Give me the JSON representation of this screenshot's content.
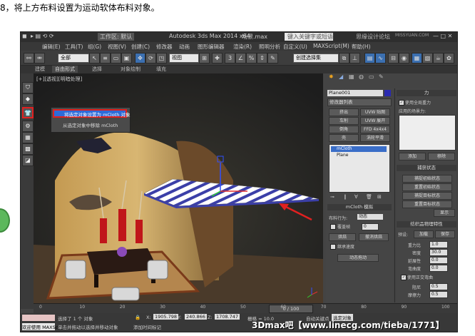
{
  "instruction": "8，将上方布料设置为运动软体布料对象。",
  "titlebar": {
    "workspace": "工作区: 默认",
    "app_title": "Autodesk 3ds Max  2014 x64",
    "file_name": "场景.max",
    "search_placeholder": "键入关键字或短语",
    "logo_text": "MISSYUAN.COM",
    "forum_text": "思缘设计论坛"
  },
  "menu": [
    "编辑(E)",
    "工具(T)",
    "组(G)",
    "视图(V)",
    "创建(C)",
    "修改器",
    "动画",
    "图形编辑器",
    "渲染(R)",
    "照明分析",
    "自定义(U)",
    "MAXScript(M)",
    "帮助(H)"
  ],
  "toolbar": {
    "filter": "全部",
    "view_mode": "视图",
    "selection_set": "创建选择集"
  },
  "ribbon": [
    "建模",
    "自由形式",
    "选择",
    "对象绘制",
    "填充"
  ],
  "viewport": {
    "label": "[+][透视][明暗处理]"
  },
  "popup": {
    "item1": "将选定对象设置为 mCloth 对象",
    "item2": "从选定对象中移除 mCloth"
  },
  "cmd_panel": {
    "object_name": "Plane001",
    "modifier_list": "修改器列表",
    "buttons": [
      "挤出",
      "UVW 贴图",
      "车削",
      "UVW 展开",
      "倒角",
      "FFD 4x4x4",
      "壳",
      "涡轮平滑"
    ],
    "stack": [
      "mCloth",
      "Plane"
    ],
    "mcloth_header": "mCloth 模拟",
    "cloth_behavior_label": "布料行为:",
    "cloth_behavior_value": "动态",
    "override_label": "覆盖帧",
    "override_value": "0",
    "bake_label": "烘焙",
    "undo_bake_label": "撤消烘焙",
    "inherit_label": "继承速度",
    "live_drag_label": "动态拖动"
  },
  "right_panel": {
    "force_header": "力",
    "use_global_gravity": "使用全局重力",
    "applied_forces": "应用的场景力:",
    "add": "添加",
    "remove": "移除",
    "capture_header": "捕获状态",
    "capture_initial": "捕捉初始状态",
    "reset_initial": "重置初始状态",
    "capture_target": "捕捉目标状态",
    "reset_target": "重置目标状态",
    "show": "显示",
    "physics_header": "纺织品物理特性",
    "preset_label": "预设:",
    "load": "加载",
    "save": "保存",
    "params": [
      {
        "label": "重力比",
        "value": "1.0"
      },
      {
        "label": "密度",
        "value": "30.0"
      },
      {
        "label": "延展性",
        "value": "0.0"
      },
      {
        "label": "弯曲度",
        "value": "0.0"
      }
    ],
    "use_ortho": "使用正交弯曲",
    "damping_label": "阻尼",
    "damping_value": "0.5",
    "friction_label": "摩擦力",
    "friction_value": "0.5"
  },
  "timeline": {
    "frame_text": "0 / 100",
    "ticks": [
      "0",
      "10",
      "20",
      "30",
      "40",
      "50",
      "60",
      "70",
      "80",
      "90",
      "100"
    ]
  },
  "status": {
    "selected": "选择了 1 个 对象",
    "hint": "单击并拖动以选择并移动对象",
    "welcome": "欢迎使用 MAXScr",
    "x_label": "X:",
    "x_value": "1905.798",
    "y_label": "Y:",
    "y_value": "240.866",
    "z_label": "Z:",
    "z_value": "1708.747",
    "grid": "栅格 = 10.0",
    "autokey": "自动关键点",
    "selected_obj": "选定对象",
    "add_time_tag": "添加时间标记"
  },
  "watermark": "3Dmax吧【www.linecg.com/tieba/1771】",
  "colors": {
    "ui_bg": "#444444",
    "highlight_red": "#e02020",
    "select_blue": "#2d6bd8"
  }
}
